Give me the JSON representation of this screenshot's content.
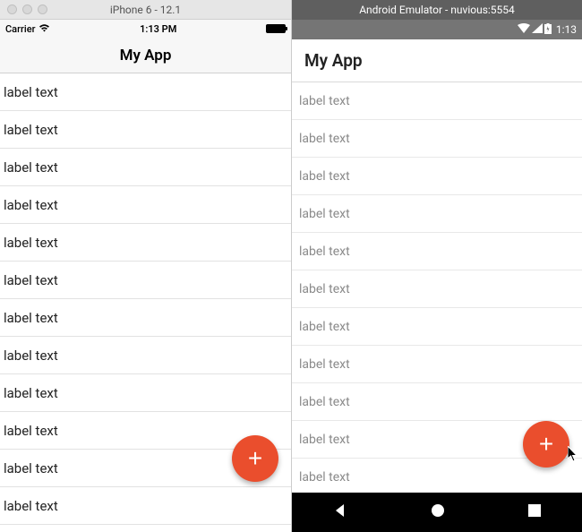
{
  "ios": {
    "window_title": "iPhone 6 - 12.1",
    "status": {
      "carrier": "Carrier",
      "time": "1:13 PM"
    },
    "header_title": "My App",
    "list_items": [
      "label text",
      "label text",
      "label text",
      "label text",
      "label text",
      "label text",
      "label text",
      "label text",
      "label text",
      "label text",
      "label text",
      "label text"
    ],
    "fab_label": "+",
    "colors": {
      "fab": "#ea4e2d"
    }
  },
  "android": {
    "window_title": "Android Emulator - nuvious:5554",
    "status": {
      "time": "1:13"
    },
    "header_title": "My App",
    "list_items": [
      "label text",
      "label text",
      "label text",
      "label text",
      "label text",
      "label text",
      "label text",
      "label text",
      "label text",
      "label text",
      "label text"
    ],
    "fab_label": "+",
    "colors": {
      "fab": "#ea4e2d"
    }
  }
}
